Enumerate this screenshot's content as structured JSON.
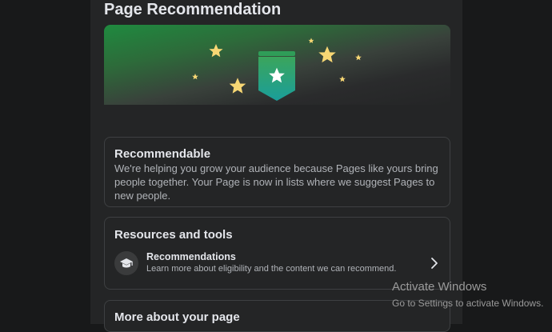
{
  "page": {
    "title": "Page Recommendation"
  },
  "recommendable": {
    "title": "Recommendable",
    "body": "We're helping you grow your audience because Pages like yours bring people together. Your Page is now in lists where we suggest Pages to new people."
  },
  "resources": {
    "title": "Resources and tools",
    "item": {
      "label": "Recommendations",
      "description": "Learn more about eligibility and the content we can recommend.",
      "icon": "graduation-cap-icon",
      "chevron_icon": "chevron-right-icon"
    }
  },
  "more": {
    "title": "More about your page"
  },
  "watermark": {
    "title": "Activate Windows",
    "subtitle": "Go to Settings to activate Windows."
  },
  "colors": {
    "background": "#18191a",
    "panel": "#242526",
    "accent_green": "#1f8a3f",
    "star": "#f7d774",
    "badge_top": "#3ba55c",
    "badge_bottom": "#1a9e9a"
  }
}
